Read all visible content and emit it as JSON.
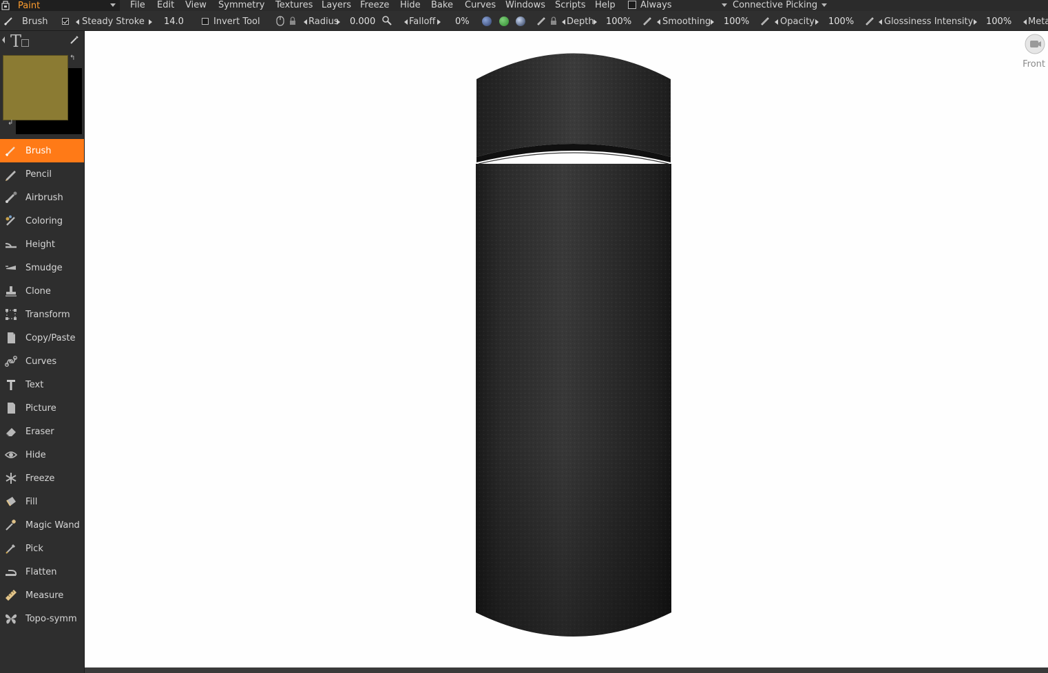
{
  "app": {
    "room": "Paint"
  },
  "menu": {
    "items": [
      "File",
      "Edit",
      "View",
      "Symmetry",
      "Textures",
      "Layers",
      "Freeze",
      "Hide",
      "Bake",
      "Curves",
      "Windows",
      "Scripts",
      "Help"
    ],
    "always_label": "Always",
    "picking_label": "Connective  Picking"
  },
  "toolbar": {
    "tool_name": "Brush",
    "steady_stroke_label": "Steady  Stroke",
    "steady_stroke_checked": true,
    "steady_stroke_value": "14.0",
    "invert_tool_label": "Invert  Tool",
    "invert_tool_checked": false,
    "radius_label": "Radius",
    "radius_value": "0.000",
    "falloff_label": "Falloff",
    "falloff_value": "0%",
    "depth_label": "Depth",
    "depth_value": "100%",
    "smoothing_label": "Smoothing",
    "smoothing_value": "100%",
    "opacity_label": "Opacity",
    "opacity_value": "100%",
    "glossiness_label": "Glossiness  Intensity",
    "glossiness_value": "100%",
    "meta_label": "Meta"
  },
  "colors": {
    "primary": "#8b7b33",
    "secondary": "#000000",
    "accent": "#ff7a17",
    "room_text": "#ff9d2e"
  },
  "tools": [
    {
      "label": "Brush",
      "icon": "brush-icon",
      "active": true
    },
    {
      "label": "Pencil",
      "icon": "pencil-icon",
      "active": false
    },
    {
      "label": "Airbrush",
      "icon": "airbrush-icon",
      "active": false
    },
    {
      "label": "Coloring",
      "icon": "coloring-icon",
      "active": false
    },
    {
      "label": "Height",
      "icon": "height-icon",
      "active": false
    },
    {
      "label": "Smudge",
      "icon": "smudge-icon",
      "active": false
    },
    {
      "label": "Clone",
      "icon": "clone-stamp-icon",
      "active": false
    },
    {
      "label": "Transform",
      "icon": "transform-icon",
      "active": false
    },
    {
      "label": "Copy/Paste",
      "icon": "copy-paste-icon",
      "active": false
    },
    {
      "label": "Curves",
      "icon": "curves-icon",
      "active": false
    },
    {
      "label": "Text",
      "icon": "text-icon",
      "active": false
    },
    {
      "label": "Picture",
      "icon": "picture-icon",
      "active": false
    },
    {
      "label": "Eraser",
      "icon": "eraser-icon",
      "active": false
    },
    {
      "label": "Hide",
      "icon": "eye-icon",
      "active": false
    },
    {
      "label": "Freeze",
      "icon": "snowflake-icon",
      "active": false
    },
    {
      "label": "Fill",
      "icon": "fill-bucket-icon",
      "active": false
    },
    {
      "label": "Magic  Wand",
      "icon": "magic-wand-icon",
      "active": false
    },
    {
      "label": "Pick",
      "icon": "eyedropper-icon",
      "active": false
    },
    {
      "label": "Flatten",
      "icon": "iron-icon",
      "active": false
    },
    {
      "label": "Measure",
      "icon": "ruler-icon",
      "active": false
    },
    {
      "label": "Topo-symm",
      "icon": "butterfly-icon",
      "active": false
    }
  ],
  "viewport": {
    "view_name": "Front"
  }
}
